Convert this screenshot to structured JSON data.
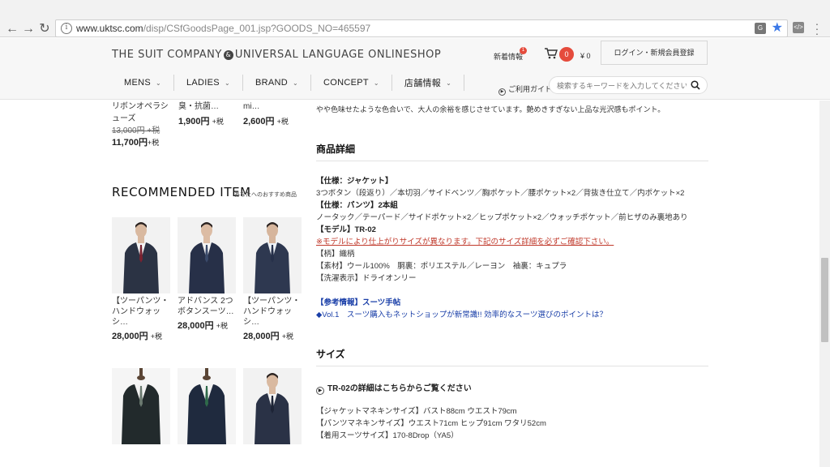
{
  "browser": {
    "url_host": "www.uktsc.com",
    "url_path": "/disp/CSfGoodsPage_001.jsp?GOODS_NO=465597",
    "nav_icons": [
      "back-icon",
      "forward-icon",
      "reload-icon"
    ]
  },
  "header": {
    "logo": "THE SUIT COMPANY",
    "logo_amp": "&",
    "logo_tail": "UNIVERSAL LANGUAGE ONLINESHOP",
    "news_label": "新着情報",
    "news_badge": "1",
    "cart_count": "0",
    "cart_total": "¥ 0",
    "login_label": "ログイン・新規会員登録",
    "guide_label": "ご利用ガイド",
    "search_placeholder": "検索するキーワードを入力してください",
    "nav": [
      {
        "label": "MENS"
      },
      {
        "label": "LADIES"
      },
      {
        "label": "BRAND"
      },
      {
        "label": "CONCEPT"
      },
      {
        "label": "店舗情報"
      }
    ]
  },
  "prev_items": [
    {
      "name": "リボンオペラシューズ",
      "old_price": "13,000円 +税",
      "price": "11,700円",
      "tax": "+税"
    },
    {
      "name": "臭・抗菌…",
      "price": "1,900円",
      "tax": "+税"
    },
    {
      "name": "mi…",
      "price": "2,600円",
      "tax": "+税"
    }
  ],
  "recommended": {
    "title": "RECOMMENDED ITEM",
    "subtitle": "あなたへのおすすめ商品",
    "items": [
      {
        "name": "【ツーパンツ・ハンドウォッシ…",
        "price": "28,000円",
        "tax": "+税"
      },
      {
        "name": "アドバンス 2つボタンスーツ…",
        "price": "28,000円",
        "tax": "+税"
      },
      {
        "name": "【ツーパンツ・ハンドウォッシ…",
        "price": "28,000円",
        "tax": "+税"
      }
    ]
  },
  "detail": {
    "desc_top": "やや色味せたような色合いで、大人の余裕を感じさせています。艶めきすぎない上品な光沢感もポイント。",
    "section_title": "商品詳細",
    "spec_lines": [
      {
        "text": "【仕様：ジャケット】",
        "style": "b"
      },
      {
        "text": "3つボタン（段返り）／本切羽／サイドベンツ／胸ポケット／腰ポケット×2／背抜き仕立て／内ポケット×2",
        "style": ""
      },
      {
        "text": "【仕様：パンツ】2本組",
        "style": "b"
      },
      {
        "text": "ノータック／テーパード／サイドポケット×2／ヒップポケット×2／ウォッチポケット／前ヒザのみ裏地あり",
        "style": ""
      },
      {
        "text": "【モデル】TR-02",
        "style": "b"
      },
      {
        "text": "※モデルにより仕上がりサイズが異なります。下記のサイズ詳細を必ずご確認下さい。",
        "style": "red"
      },
      {
        "text": "【柄】織柄",
        "style": ""
      },
      {
        "text": "【素材】ウール100%　胴裏：ポリエステル／レーヨン　袖裏：キュプラ",
        "style": ""
      },
      {
        "text": "【洗濯表示】ドライオンリー",
        "style": ""
      },
      {
        "text": "",
        "style": ""
      },
      {
        "text": "【参考情報】スーツ手帖",
        "style": "bold-blue"
      },
      {
        "text": "◆Vol.1　スーツ購入もネットショップが新常識!! 効率的なスーツ選びのポイントは？",
        "style": "blue"
      }
    ],
    "size_title": "サイズ",
    "size_link": "TR-02の詳細はこちらからご覧ください",
    "size_lines": [
      "【ジャケットマネキンサイズ】バスト88cm ウエスト79cm",
      "【パンツマネキンサイズ】ウエスト71cm ヒップ91cm ワタリ52cm",
      "【着用スーツサイズ】170-8Drop（YA5）"
    ]
  }
}
